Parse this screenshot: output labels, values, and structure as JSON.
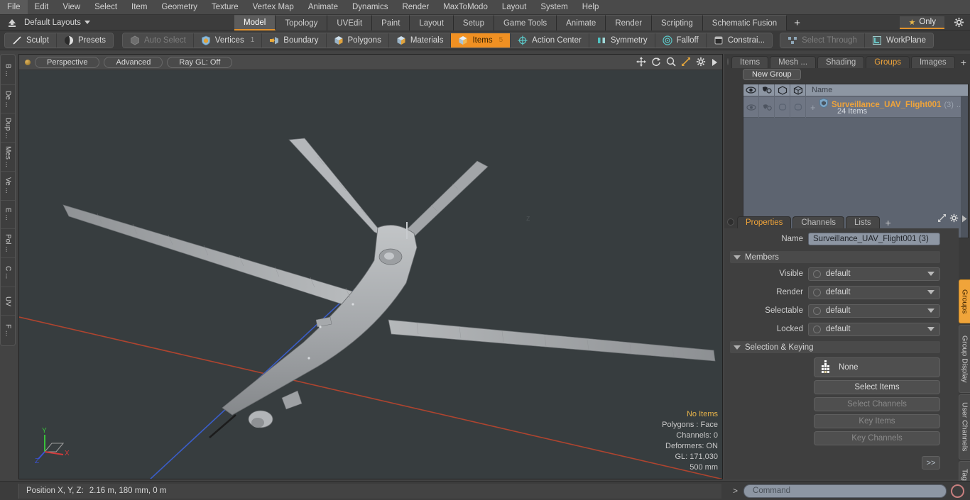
{
  "menu": {
    "items": [
      "File",
      "Edit",
      "View",
      "Select",
      "Item",
      "Geometry",
      "Texture",
      "Vertex Map",
      "Animate",
      "Dynamics",
      "Render",
      "MaxToModo",
      "Layout",
      "System",
      "Help"
    ]
  },
  "layoutbar": {
    "home_icon": "home-up-icon",
    "layout_label": "Default Layouts",
    "tabs": [
      {
        "label": "Model",
        "active": true
      },
      {
        "label": "Topology",
        "active": false
      },
      {
        "label": "UVEdit",
        "active": false
      },
      {
        "label": "Paint",
        "active": false
      },
      {
        "label": "Layout",
        "active": false
      },
      {
        "label": "Setup",
        "active": false
      },
      {
        "label": "Game Tools",
        "active": false
      },
      {
        "label": "Animate",
        "active": false
      },
      {
        "label": "Render",
        "active": false
      },
      {
        "label": "Scripting",
        "active": false
      },
      {
        "label": "Schematic Fusion",
        "active": false
      }
    ],
    "add_tab_label": "+",
    "only_label": "Only",
    "star_icon": "star-icon",
    "gear_icon": "gear-icon"
  },
  "modebar": {
    "left_group": [
      {
        "label": "Sculpt",
        "icon": "brush-stroke-icon",
        "state": "normal"
      },
      {
        "label": "Presets",
        "icon": "sphere-icon",
        "state": "normal"
      }
    ],
    "main_group": [
      {
        "label": "Auto Select",
        "icon": "cube-gray-icon",
        "state": "disabled",
        "count": ""
      },
      {
        "label": "Vertices",
        "icon": "shield-icon",
        "state": "normal",
        "count": "1"
      },
      {
        "label": "Boundary",
        "icon": "arrow-cube-icon",
        "state": "normal",
        "count": ""
      },
      {
        "label": "Polygons",
        "icon": "cube-icon",
        "state": "normal",
        "count": ""
      },
      {
        "label": "Materials",
        "icon": "cube-icon",
        "state": "normal",
        "count": ""
      },
      {
        "label": "Items",
        "icon": "cube-icon",
        "state": "selected",
        "count": "5"
      },
      {
        "label": "Action Center",
        "icon": "crosshair-icon",
        "state": "normal",
        "count": ""
      },
      {
        "label": "Symmetry",
        "icon": "symmetry-icon",
        "state": "normal",
        "count": ""
      },
      {
        "label": "Falloff",
        "icon": "target-icon",
        "state": "normal",
        "count": ""
      },
      {
        "label": "Constrai...",
        "icon": "square-icon",
        "state": "normal",
        "count": ""
      }
    ],
    "right_group": [
      {
        "label": "Select Through",
        "icon": "select-through-icon",
        "state": "disabled"
      },
      {
        "label": "WorkPlane",
        "icon": "workplane-icon",
        "state": "normal"
      }
    ]
  },
  "left_rail": {
    "tabs": [
      "B ...",
      "De ...",
      "Dup ...",
      "Mes ...",
      "Ve ...",
      "E ...",
      "Pol ...",
      "C ...",
      "UV",
      "F ..."
    ]
  },
  "viewport": {
    "pills": [
      "Perspective",
      "Advanced",
      "Ray GL: Off"
    ],
    "tool_icons": [
      "move-icon",
      "rotate-icon",
      "zoom-icon",
      "fit-icon",
      "gear-icon",
      "play-icon"
    ],
    "gizmo": {
      "x": "X",
      "y": "Y",
      "z": "Z"
    },
    "stats": [
      {
        "text": "No Items",
        "highlight": true
      },
      {
        "text": "Polygons : Face",
        "highlight": false
      },
      {
        "text": "Channels: 0",
        "highlight": false
      },
      {
        "text": "Deformers: ON",
        "highlight": false
      },
      {
        "text": "GL: 171,030",
        "highlight": false
      },
      {
        "text": "500 mm",
        "highlight": false
      }
    ]
  },
  "right_panel": {
    "tabs": [
      {
        "label": "Items",
        "active": false
      },
      {
        "label": "Mesh ...",
        "active": false
      },
      {
        "label": "Shading",
        "active": false
      },
      {
        "label": "Groups",
        "active": true
      },
      {
        "label": "Images",
        "active": false
      }
    ],
    "tab_plus": "+",
    "expand_icon": "expand-icon",
    "more_icon": "play-icon",
    "new_group_label": "New Group",
    "list": {
      "columns": [
        "eye-icon",
        "render-icon",
        "cube-outline-icon",
        "cube-wire-icon"
      ],
      "name_header": "Name",
      "rows": [
        {
          "name": "Surveillance_UAV_Flight001",
          "count": "(3)",
          "ellipsis": "...",
          "subtitle": "24 Items",
          "icon": "shield-icon"
        }
      ]
    },
    "properties": {
      "tabs": [
        {
          "label": "Properties",
          "active": true
        },
        {
          "label": "Channels",
          "active": false
        },
        {
          "label": "Lists",
          "active": false
        }
      ],
      "tab_plus": "+",
      "name_label": "Name",
      "name_value": "Surveillance_UAV_Flight001 (3)",
      "members_header": "Members",
      "fields": [
        {
          "label": "Visible",
          "value": "default"
        },
        {
          "label": "Render",
          "value": "default"
        },
        {
          "label": "Selectable",
          "value": "default"
        },
        {
          "label": "Locked",
          "value": "default"
        }
      ],
      "selection_header": "Selection & Keying",
      "none_value": "None",
      "none_icon": "dots-grid-icon",
      "buttons": [
        {
          "label": "Select Items",
          "enabled": true
        },
        {
          "label": "Select Channels",
          "enabled": false
        },
        {
          "label": "Key Items",
          "enabled": false
        },
        {
          "label": "Key Channels",
          "enabled": false
        }
      ],
      "more_button": ">>"
    },
    "vertical_tabs": [
      {
        "label": "Groups",
        "active": true
      },
      {
        "label": "Group Display",
        "active": false
      },
      {
        "label": "User Channels",
        "active": false
      },
      {
        "label": "Tags",
        "active": false
      }
    ]
  },
  "bottom": {
    "status_label": "Position X, Y, Z:",
    "status_value": "2.16 m, 180 mm, 0 m",
    "command_prompt": ">",
    "command_placeholder": "Command",
    "record_icon": "record-circle-icon"
  },
  "colors": {
    "accent_orange": "#f0a43a",
    "selected_orange": "#f09022",
    "panel_bg": "#3a3a3a",
    "viewport_bg": "#373d3f",
    "list_bg": "#6f7684"
  }
}
